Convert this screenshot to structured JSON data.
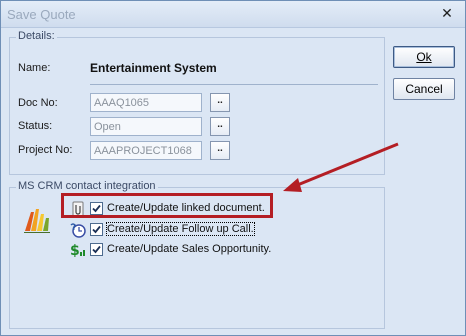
{
  "window": {
    "title": "Save Quote",
    "close_icon": "close-x-icon"
  },
  "details": {
    "legend": "Details:",
    "name_label": "Name:",
    "name_value": "Entertainment System",
    "doc_no_label": "Doc No:",
    "doc_no_value": "AAAQ1065",
    "status_label": "Status:",
    "status_value": "Open",
    "project_no_label": "Project No:",
    "project_no_value": "AAAPROJECT1068",
    "browse_label": ".."
  },
  "buttons": {
    "ok_label": "Ok",
    "cancel_label": "Cancel"
  },
  "integration": {
    "legend": "MS CRM contact integration",
    "logo_icon": "ms-crm-logo-icon",
    "options": [
      {
        "label": "Create/Update linked document.",
        "checked": true,
        "icon": "paperclip-icon"
      },
      {
        "label": "Create/Update Follow up Call.",
        "checked": true,
        "icon": "phone-call-icon"
      },
      {
        "label": "Create/Update Sales Opportunity.",
        "checked": true,
        "icon": "dollar-icon"
      }
    ]
  },
  "annotation": {
    "highlight_color": "#b41e24",
    "arrow_color": "#b41e24"
  }
}
